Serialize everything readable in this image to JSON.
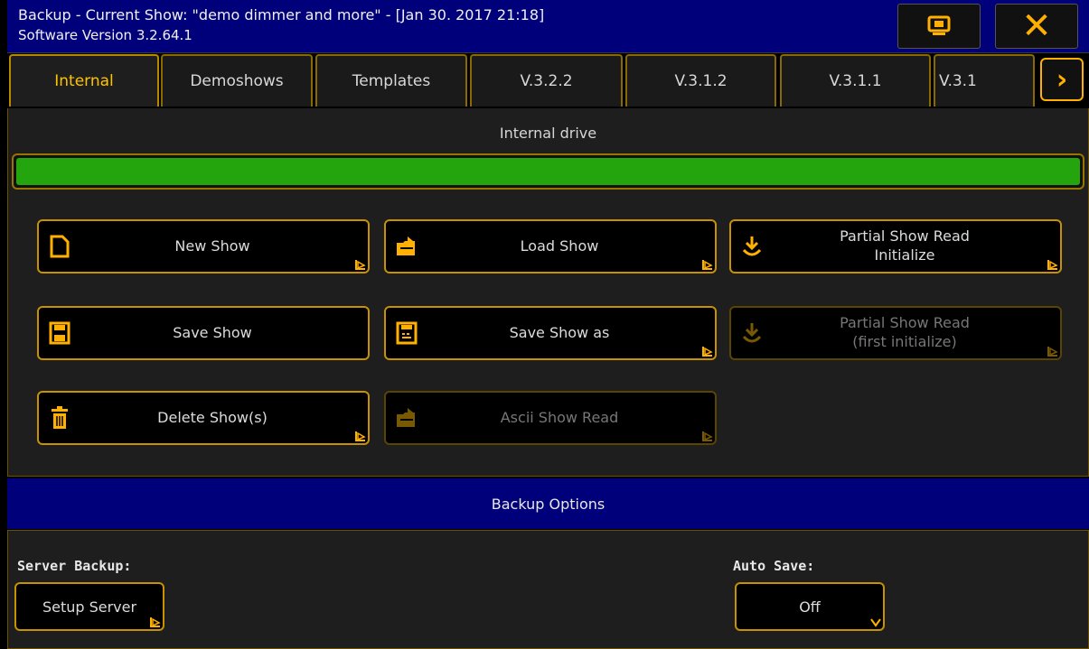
{
  "window": {
    "title_line1": "Backup - Current Show: \"demo dimmer and more\" - [Jan 30. 2017 21:18]",
    "title_line2": "Software Version 3.2.64.1"
  },
  "tabs": [
    {
      "label": "Internal",
      "active": true
    },
    {
      "label": "Demoshows"
    },
    {
      "label": "Templates"
    },
    {
      "label": "V.3.2.2"
    },
    {
      "label": "V.3.1.2"
    },
    {
      "label": "V.3.1.1"
    },
    {
      "label": "V.3.1"
    }
  ],
  "drive": {
    "label": "Internal drive",
    "usage_fraction": 1.0
  },
  "actions": [
    {
      "label": "New Show",
      "icon": "new-document-icon",
      "enabled": true
    },
    {
      "label": "Load Show",
      "icon": "load-folder-icon",
      "enabled": true
    },
    {
      "label": "Partial Show Read\nInitialize",
      "icon": "partial-read-icon",
      "enabled": true
    },
    {
      "label": "Save Show",
      "icon": "floppy-disk-icon",
      "enabled": true
    },
    {
      "label": "Save Show as",
      "icon": "floppy-disk-as-icon",
      "enabled": true
    },
    {
      "label": "Partial Show Read\n(first initialize)",
      "icon": "partial-read-icon",
      "enabled": false
    },
    {
      "label": "Delete Show(s)",
      "icon": "trash-icon",
      "enabled": true
    },
    {
      "label": "Ascii Show Read",
      "icon": "load-folder-icon",
      "enabled": false
    }
  ],
  "options": {
    "header": "Backup Options",
    "server_label": "Server Backup:",
    "server_button": "Setup Server",
    "autosave_label": "Auto Save:",
    "autosave_value": "Off"
  },
  "colors": {
    "accent": "#ffb000",
    "title_bar": "#00007a",
    "drive_fill": "#25a50d"
  }
}
